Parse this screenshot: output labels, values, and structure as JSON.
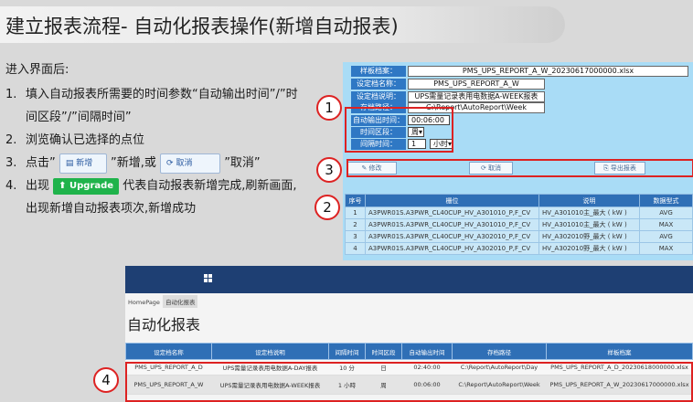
{
  "slide": {
    "title": "建立报表流程- 自动化报表操作(新增自动报表)",
    "intro": "进入界面后:",
    "steps": [
      {
        "num": "1.",
        "text": "填入自动报表所需要的时间参数“自动输出时间”/”时间区段”/”间隔时间”"
      },
      {
        "num": "2.",
        "text": "浏览确认已选择的点位"
      },
      {
        "num": "3.",
        "prefix": "点击”",
        "btn1": "新增",
        "mid": "”新增,或",
        "btn2": "取消",
        "suffix": "”取消”"
      },
      {
        "num": "4.",
        "prefix": "出现",
        "badge": "Upgrade",
        "suffix": "代表自动报表新增完成,刷新画面,出现新增自动报表项次,新增成功"
      }
    ]
  },
  "form": {
    "file_label": "样板档案：",
    "file_value": "PMS_UPS_REPORT_A_W_20230617000000.xlsx",
    "name_label": "设定档名称：",
    "name_value": "PMS_UPS_REPORT_A_W",
    "desc_label": "设定档说明：",
    "desc_value": "UPS需量记录表用电数据A-WEEK报表",
    "path_label": "存档路径：",
    "path_value": "C:\\Report\\AutoReport\\Week",
    "out_time_label": "自动输出时间：",
    "out_time_value": "00:06:00",
    "period_label": "时间区段：",
    "period_value": "周",
    "interval_label": "间隔时间：",
    "interval_value": "1",
    "interval_unit": "小时",
    "btn_modify": "修改",
    "btn_cancel": "取消",
    "btn_export": "导出报表"
  },
  "points_table": {
    "headers": [
      "序号",
      "栅位",
      "说明",
      "数据型式"
    ],
    "rows": [
      [
        "1",
        "A3PWR01S.A3PWR_CL40CUP_HV_A301010_P,F_CV",
        "HV_A301010主_最大 ( kW )",
        "AVG"
      ],
      [
        "2",
        "A3PWR01S.A3PWR_CL40CUP_HV_A301010_P,F_CV",
        "HV_A301010主_最大 ( kW )",
        "MAX"
      ],
      [
        "3",
        "A3PWR01S.A3PWR_CL40CUP_HV_A302010_P,F_CV",
        "HV_A302010野_最大 ( kW )",
        "AVG"
      ],
      [
        "4",
        "A3PWR01S.A3PWR_CL40CUP_HV_A302010_P,F_CV",
        "HV_A302010野_最大 ( kW )",
        "MAX"
      ]
    ]
  },
  "markers": {
    "m1": "1",
    "m2": "2",
    "m3": "3",
    "m4": "4"
  },
  "app": {
    "breadcrumb_home": "HomePage",
    "breadcrumb_current": "自动化报表",
    "page_title": "自动化报表",
    "headers": [
      "设定档名称",
      "设定档说明",
      "间隔时间",
      "时间区段",
      "自动输出时间",
      "存档路径",
      "样板档案"
    ],
    "rows": [
      [
        "PMS_UPS_REPORT_A_D",
        "UPS需量记录表用电数据A-DAY报表",
        "10 分",
        "日",
        "02:40:00",
        "C:\\Report\\AutoReport\\Day",
        "PMS_UPS_REPORT_A_D_20230618000000.xlsx"
      ],
      [
        "PMS_UPS_REPORT_A_W",
        "UPS需量记录表用电数据A-WEEK报表",
        "1 小時",
        "周",
        "00:06:00",
        "C:\\Report\\AutoReport\\Week",
        "PMS_UPS_REPORT_A_W_20230617000000.xlsx"
      ]
    ]
  },
  "colors": {
    "accent": "#2f6fb6",
    "marker": "#dd2222",
    "panel": "#a9dcf6",
    "upgrade": "#1fb34b"
  }
}
